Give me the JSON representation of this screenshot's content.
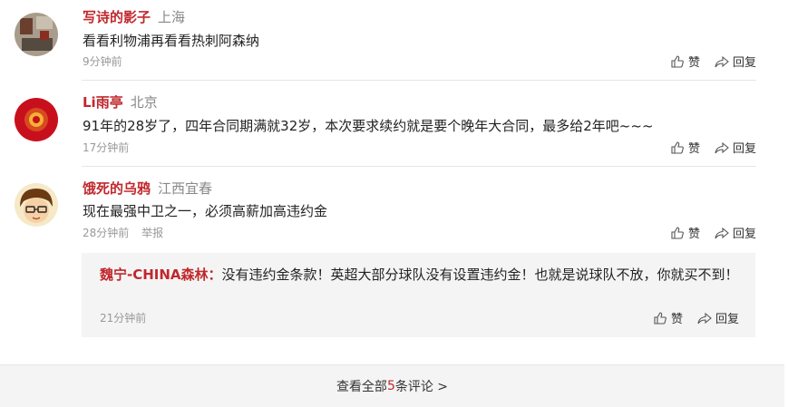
{
  "comments": [
    {
      "username": "写诗的影子",
      "location": "上海",
      "text": "看看利物浦再看看热刺阿森纳",
      "time": "9分钟前",
      "like_label": "赞",
      "reply_label": "回复"
    },
    {
      "username": "Li雨亭",
      "location": "北京",
      "text": "91年的28岁了，四年合同期满就32岁，本次要求续约就是要个晚年大合同，最多给2年吧~~~",
      "time": "17分钟前",
      "like_label": "赞",
      "reply_label": "回复"
    },
    {
      "username": "饿死的乌鸦",
      "location": "江西宜春",
      "text": "现在最强中卫之一，必须高薪加高违约金",
      "time": "28分钟前",
      "report_label": "举报",
      "like_label": "赞",
      "reply_label": "回复"
    }
  ],
  "reply": {
    "username": "魏宁-CHINA森林：",
    "text": "没有违约金条款！英超大部分球队没有设置违约金！也就是说球队不放，你就买不到！",
    "time": "21分钟前",
    "like_label": "赞",
    "reply_label": "回复"
  },
  "footer": {
    "prefix": "查看全部",
    "count": "5",
    "suffix": "条评论 >"
  },
  "colors": {
    "username": "#c0282d",
    "muted": "#999999",
    "panel": "#f4f4f4"
  }
}
